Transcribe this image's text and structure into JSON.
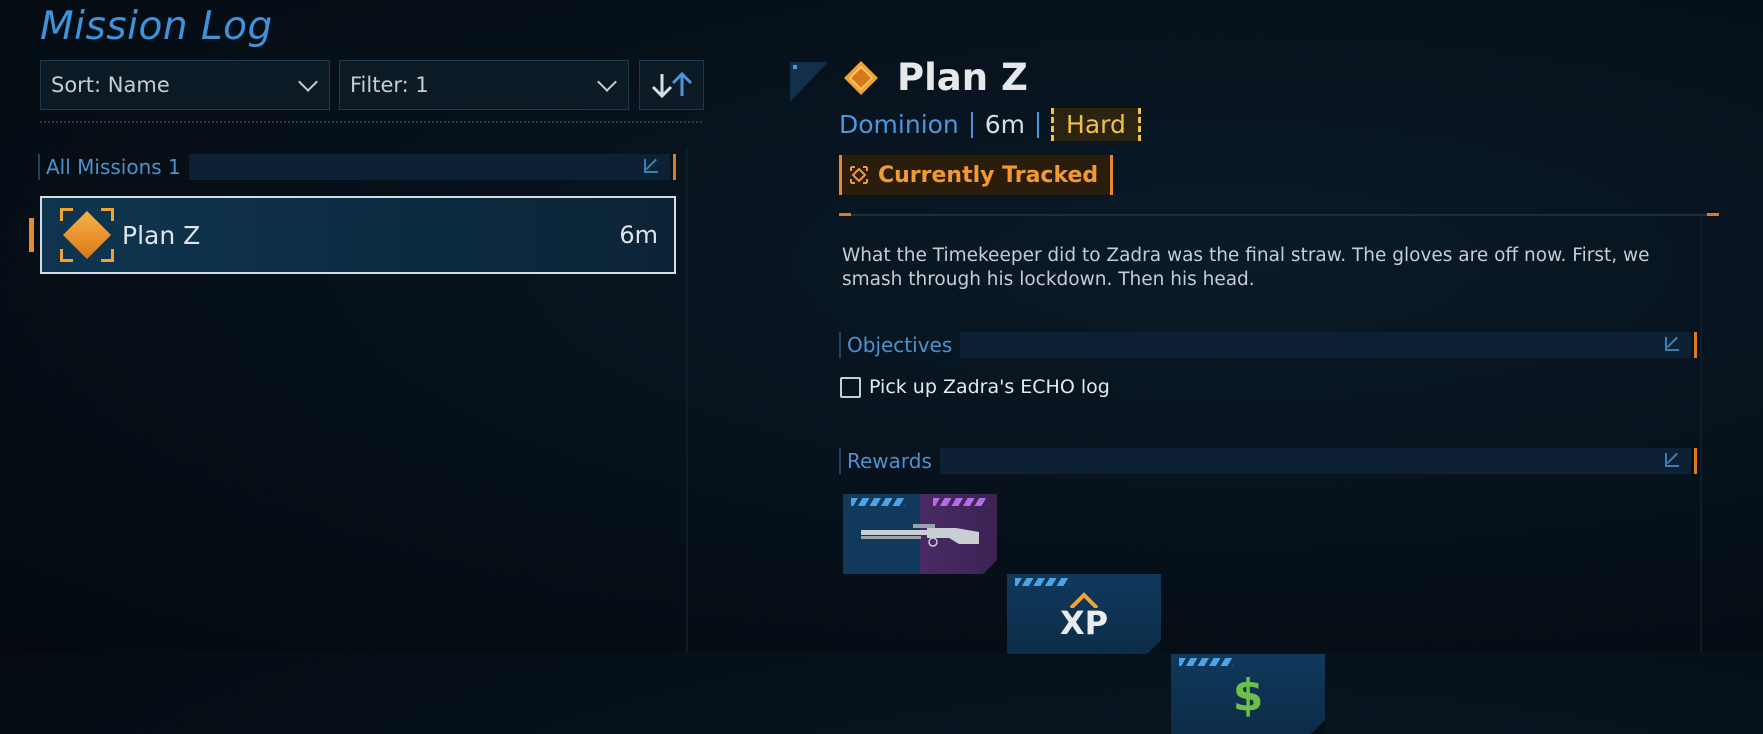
{
  "header": {
    "title": "Mission Log"
  },
  "controls": {
    "sort_label": "Sort: Name",
    "filter_label": "Filter: 1",
    "sort_order_icon": "sort-arrows-icon"
  },
  "list": {
    "section_label": "All Missions 1",
    "missions": [
      {
        "name": "Plan Z",
        "time": "6m",
        "icon": "mission-diamond-icon",
        "selected": true
      }
    ]
  },
  "detail": {
    "title": "Plan Z",
    "location": "Dominion",
    "duration": "6m",
    "difficulty": "Hard",
    "tracked_label": "Currently Tracked",
    "description": "What the Timekeeper did to Zadra was the final straw. The gloves are off now. First, we smash through his lockdown. Then his head.",
    "objectives_label": "Objectives",
    "objectives": [
      {
        "text": "Pick up Zadra's ECHO log",
        "done": false
      }
    ],
    "rewards_label": "Rewards",
    "rewards": [
      {
        "type": "weapon",
        "icon": "shotgun-icon"
      },
      {
        "type": "xp",
        "icon": "xp-icon",
        "text": "XP"
      },
      {
        "type": "cash",
        "icon": "cash-icon",
        "text": "$"
      }
    ]
  },
  "colors": {
    "accent_blue": "#3f93da",
    "accent_orange": "#e8882a",
    "difficulty_yellow": "#f4c04a",
    "cash_green": "#6cc04a"
  }
}
